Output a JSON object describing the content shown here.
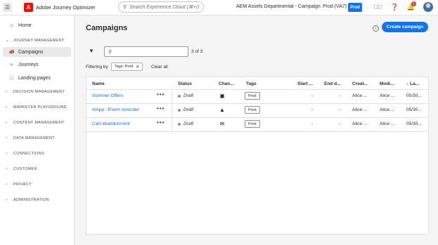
{
  "app": {
    "name": "Adobe Journey Optimizer",
    "logo_letter": "A",
    "search_placeholder": "Search Experience Cloud (⌘+/)",
    "org": "AEM Assets Departmental - Campaign",
    "sandbox": "Prod (VA7)",
    "sandbox_badge": "Prod",
    "notification_count": "1",
    "brand_color": "#1473e6",
    "logo_color": "#eb1000"
  },
  "sidebar": {
    "top_items": [
      {
        "label": "Home",
        "icon": "home-icon"
      }
    ],
    "journey_section": "JOURNEY MANAGEMENT",
    "journey_items": [
      {
        "label": "Campaigns",
        "icon": "megaphone-icon",
        "active": true
      },
      {
        "label": "Journeys",
        "icon": "journey-icon"
      },
      {
        "label": "Landing pages",
        "icon": "page-icon"
      }
    ],
    "sections": [
      "DECISION MANAGEMENT",
      "MARKETER PLAYGROUND",
      "CONTENT MANAGEMENT",
      "DATA MANAGEMENT",
      "CONNECTIONS",
      "CUSTOMER",
      "PRIVACY",
      "ADMINISTRATION"
    ]
  },
  "main": {
    "title": "Campaigns",
    "create_button": "Create campaign",
    "count": "3 of 3",
    "filtering_label": "Filtering by",
    "filter_chip": "Tags: Prod",
    "clear_all": "Clear all",
    "table": {
      "headers": {
        "name": "Name",
        "status": "Status",
        "channel": "Chan...",
        "tags": "Tags",
        "start": "Start ...",
        "end": "End d...",
        "created": "Creat...",
        "modified": "Modi...",
        "last": "La..."
      },
      "rows": [
        {
          "name": "Summer Offers",
          "more": "•••",
          "status": "Draft",
          "channel_icon": "push-notification-icon",
          "tag": "Prod",
          "start": "-",
          "end": "-",
          "created": "Alice ...",
          "modified": "Alice ...",
          "last": "05/30..."
        },
        {
          "name": "InApp - Event reminder",
          "more": "•••",
          "status": "Draft",
          "channel_icon": "in-app-icon",
          "tag": "Prod",
          "start": "-",
          "end": "-",
          "created": "Alice ...",
          "modified": "Alice ...",
          "last": "05/30..."
        },
        {
          "name": "Cart abandonment",
          "more": "•••",
          "status": "Draft",
          "channel_icon": "email-icon",
          "tag": "Prod",
          "start": "-",
          "end": "-",
          "created": "Alice ...",
          "modified": "Alice ...",
          "last": "05/30..."
        }
      ]
    }
  }
}
